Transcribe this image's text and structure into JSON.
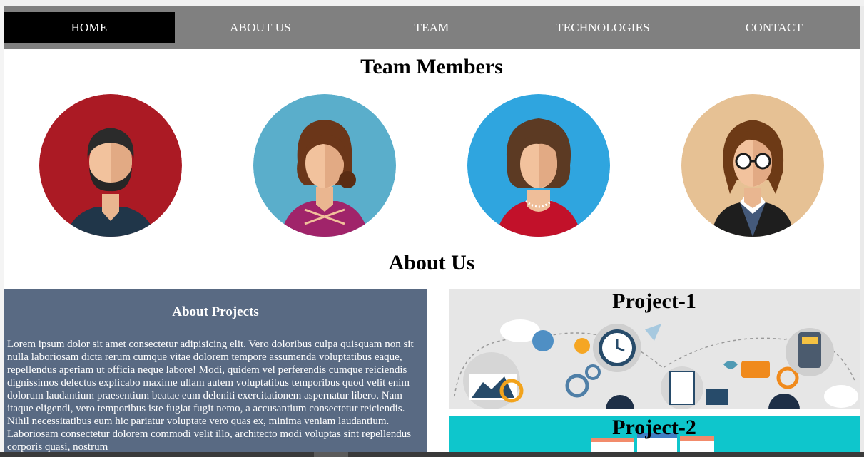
{
  "nav": {
    "items": [
      {
        "label": "HOME"
      },
      {
        "label": "ABOUT US"
      },
      {
        "label": "TEAM"
      },
      {
        "label": "TECHNOLOGIES"
      },
      {
        "label": "CONTACT"
      }
    ],
    "active": "HOME",
    "colors": {
      "bar": "#808080",
      "active": "#000000",
      "text": "#ffffff"
    }
  },
  "team": {
    "title": "Team Members",
    "members": [
      {
        "icon": "bearded-man-avatar",
        "bg": "#ab1a24"
      },
      {
        "icon": "woman-ponytail-avatar",
        "bg": "#5aaecb"
      },
      {
        "icon": "woman-curly-hair-avatar",
        "bg": "#2fa5df"
      },
      {
        "icon": "woman-glasses-avatar",
        "bg": "#e6c194"
      }
    ]
  },
  "about": {
    "title": "About Us",
    "panel_title": "About Projects",
    "panel_text": "Lorem ipsum dolor sit amet consectetur adipisicing elit. Vero doloribus culpa quisquam non sit nulla laboriosam dicta rerum cumque vitae dolorem tempore assumenda voluptatibus eaque, repellendus aperiam ut officia neque labore! Modi, quidem vel perferendis cumque reiciendis dignissimos delectus explicabo maxime ullam autem voluptatibus temporibus quod velit enim dolorum laudantium praesentium beatae eum deleniti exercitationem aspernatur libero. Nam itaque eligendi, vero temporibus iste fugiat fugit nemo, a accusantium consectetur reiciendis. Nihil necessitatibus eum hic pariatur voluptate vero quas ex, minima veniam laudantium. Laboriosam consectetur dolorem commodi velit illo, architecto modi voluptas sint repellendus corporis quasi, nostrum",
    "panel_bg": "#596a83"
  },
  "projects": [
    {
      "title": "Project-1",
      "icon": "business-icons-illustration",
      "bg": "#e6e6e6"
    },
    {
      "title": "Project-2",
      "icon": "web-windows-illustration",
      "bg": "#0ec6cc"
    }
  ]
}
